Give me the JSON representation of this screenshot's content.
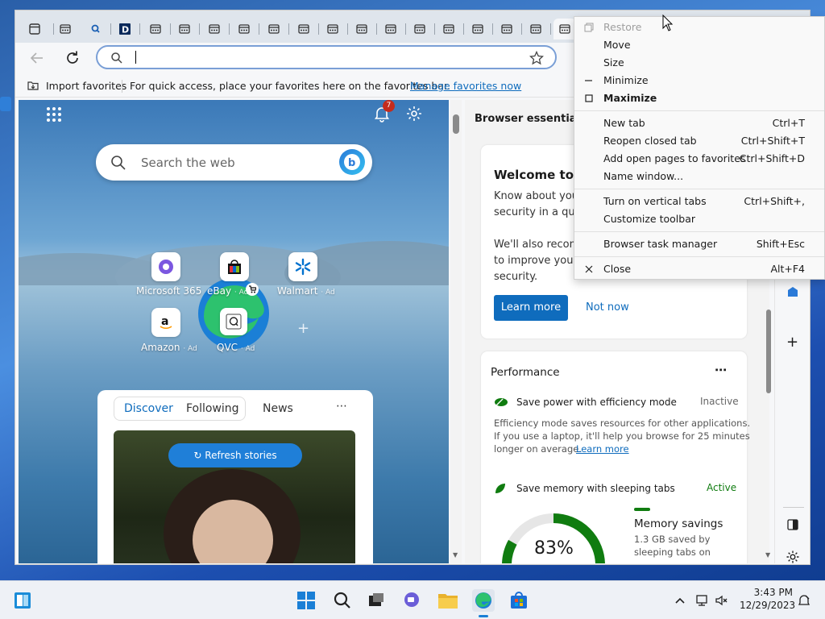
{
  "toolbar": {
    "address_value": ""
  },
  "favorites_bar": {
    "import_label": "Import favorites",
    "hint_text": "For quick access, place your favorites here on the favorites bar.",
    "manage_link": "Manage favorites now"
  },
  "newtab": {
    "notification_count": "7",
    "search_placeholder": "Search the web",
    "tiles": [
      {
        "label": "Microsoft 365",
        "ad": ""
      },
      {
        "label": "eBay",
        "ad": "· Ad"
      },
      {
        "label": "Walmart",
        "ad": "· Ad"
      },
      {
        "label": "Amazon",
        "ad": "· Ad"
      },
      {
        "label": "QVC",
        "ad": "· Ad"
      }
    ],
    "feed_tabs": [
      "Discover",
      "Following",
      "News"
    ],
    "refresh_label": "Refresh stories"
  },
  "panel": {
    "title": "Browser essentials",
    "welcome_title": "Welcome to B",
    "welcome_p1": [
      "Know about you",
      "security in a qui"
    ],
    "welcome_p2": [
      "We'll also recom",
      "to improve your",
      "security."
    ],
    "learn_more": "Learn more",
    "not_now": "Not now",
    "performance_title": "Performance",
    "efficiency_title": "Save power with efficiency mode",
    "efficiency_status": "Inactive",
    "efficiency_desc": [
      "Efficiency mode saves resources for other applications.",
      "If you use a laptop, it'll help you browse for 25 minutes",
      "longer on average."
    ],
    "efficiency_link": "Learn more",
    "sleeping_title": "Save memory with sleeping tabs",
    "sleeping_status": "Active",
    "gauge_value": "83%",
    "gauge_fraction": 0.83,
    "memory_title": "Memory savings",
    "memory_desc": [
      "1.3 GB saved by",
      "sleeping tabs on"
    ]
  },
  "menu": {
    "items": [
      {
        "label": "Restore",
        "shortcut": "",
        "disabled": true
      },
      {
        "label": "Move",
        "shortcut": ""
      },
      {
        "label": "Size",
        "shortcut": ""
      },
      {
        "label": "Minimize",
        "shortcut": ""
      },
      {
        "label": "Maximize",
        "shortcut": "",
        "bold": true
      },
      {
        "label": "New tab",
        "shortcut": "Ctrl+T"
      },
      {
        "label": "Reopen closed tab",
        "shortcut": "Ctrl+Shift+T"
      },
      {
        "label": "Add open pages to favorites",
        "shortcut": "Ctrl+Shift+D"
      },
      {
        "label": "Name window...",
        "shortcut": ""
      },
      {
        "label": "Turn on vertical tabs",
        "shortcut": "Ctrl+Shift+,"
      },
      {
        "label": "Customize toolbar",
        "shortcut": ""
      },
      {
        "label": "Browser task manager",
        "shortcut": "Shift+Esc"
      },
      {
        "label": "Close",
        "shortcut": "Alt+F4"
      }
    ]
  },
  "taskbar": {
    "time": "3:43 PM",
    "date": "12/29/2023"
  },
  "colors": {
    "accent": "#0f6cbd",
    "gauge_green": "#107c10",
    "badge_red": "#c42b1c"
  }
}
